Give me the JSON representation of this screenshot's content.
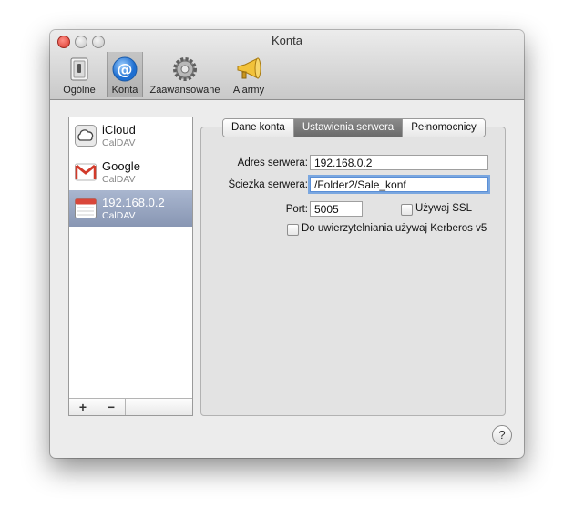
{
  "window": {
    "title": "Konta"
  },
  "toolbar": {
    "items": [
      {
        "label": "Ogólne",
        "icon": "general-switch-icon"
      },
      {
        "label": "Konta",
        "icon": "at-sign-icon"
      },
      {
        "label": "Zaawansowane",
        "icon": "gear-icon"
      },
      {
        "label": "Alarmy",
        "icon": "megaphone-icon"
      }
    ],
    "selected": "Konta"
  },
  "accounts": [
    {
      "name": "iCloud",
      "type": "CalDAV",
      "icon": "icloud-icon"
    },
    {
      "name": "Google",
      "type": "CalDAV",
      "icon": "gmail-icon"
    },
    {
      "name": "192.168.0.2",
      "type": "CalDAV",
      "icon": "calendar-icon",
      "selected": true
    }
  ],
  "sidebar_buttons": {
    "add": "+",
    "remove": "−"
  },
  "tabs": [
    {
      "label": "Dane konta"
    },
    {
      "label": "Ustawienia serwera",
      "active": true
    },
    {
      "label": "Pełnomocnicy"
    }
  ],
  "server": {
    "address_label": "Adres serwera:",
    "address_value": "192.168.0.2",
    "path_label": "Ścieżka serwera:",
    "path_value": "/Folder2/Sale_konf",
    "port_label": "Port:",
    "port_value": "5005",
    "ssl_label": "Używaj SSL",
    "ssl_checked": false,
    "kerberos_label": "Do uwierzytelniania używaj Kerberos v5",
    "kerberos_checked": false
  },
  "help": {
    "label": "?"
  },
  "colors": {
    "selection": "#8896b3",
    "active_tab": "#6b6b6b",
    "focus_ring": "#7aa7e0",
    "close": "#d9362b"
  }
}
